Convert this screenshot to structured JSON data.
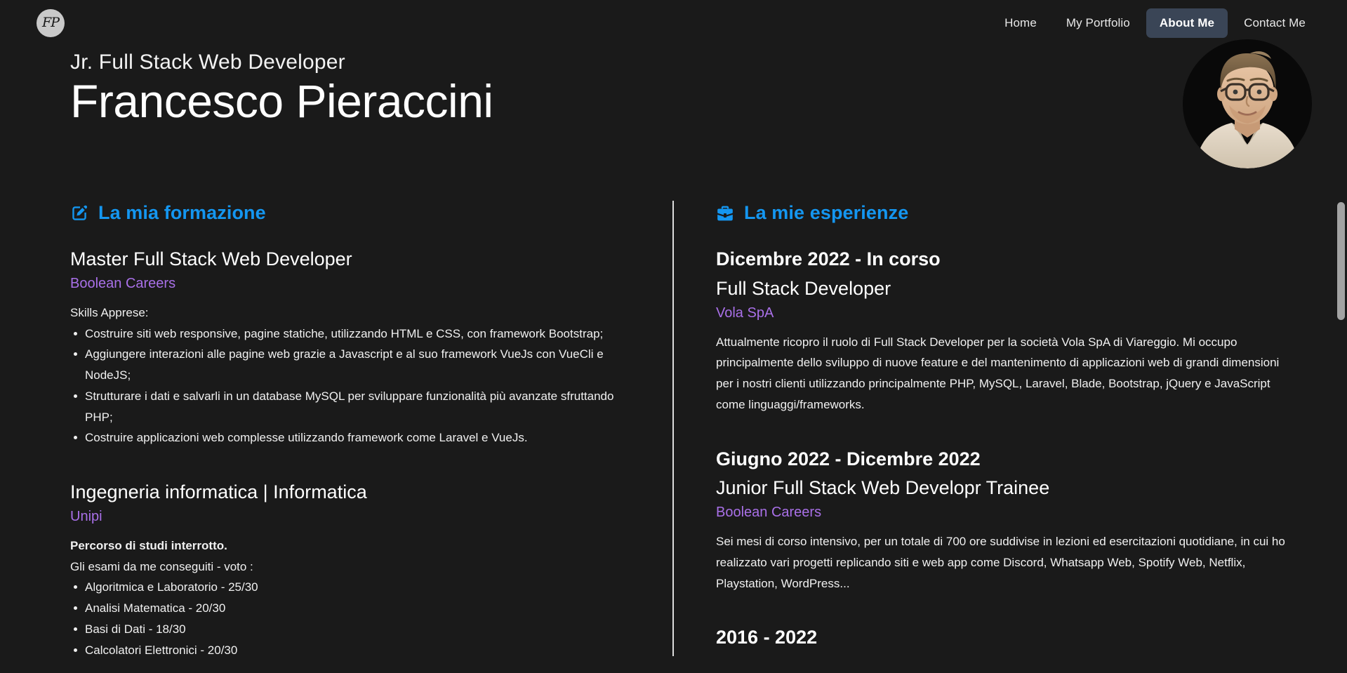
{
  "navbar": {
    "logo_text": "FP",
    "logo_icon": "fp-monogram-icon",
    "links": [
      {
        "label": "Home",
        "active": false
      },
      {
        "label": "My Portfolio",
        "active": false
      },
      {
        "label": "About Me",
        "active": true
      },
      {
        "label": "Contact Me",
        "active": false
      }
    ]
  },
  "hero": {
    "role": "Jr. Full Stack Web Developer",
    "name": "Francesco Pieraccini",
    "avatar_alt": "profile-photo"
  },
  "education": {
    "icon": "pencil-square-icon",
    "title": "La mia formazione",
    "entries": [
      {
        "title": "Master Full Stack Web Developer",
        "org": "Boolean Careers",
        "intro": "Skills Apprese:",
        "bullets": [
          "Costruire siti web responsive, pagine statiche, utilizzando HTML e CSS, con framework Bootstrap;",
          "Aggiungere interazioni alle pagine web grazie a Javascript e al suo framework VueJs con VueCli e NodeJS;",
          "Strutturare i dati e salvarli in un database MySQL per sviluppare funzionalità più avanzate sfruttando PHP;",
          "Costruire applicazioni web complesse utilizzando framework come Laravel e VueJs."
        ]
      },
      {
        "title": "Ingegneria informatica | Informatica",
        "org": "Unipi",
        "note": "Percorso di studi interrotto.",
        "intro": "Gli esami da me conseguiti - voto :",
        "bullets": [
          "Algoritmica e Laboratorio - 25/30",
          "Analisi Matematica - 20/30",
          "Basi di Dati - 18/30",
          "Calcolatori Elettronici - 20/30"
        ]
      }
    ]
  },
  "experience": {
    "icon": "briefcase-icon",
    "title": "La mie esperienze",
    "entries": [
      {
        "date": "Dicembre 2022 - In corso",
        "title": "Full Stack Developer",
        "org": "Vola SpA",
        "description": "Attualmente ricopro il ruolo di Full Stack Developer per la società Vola SpA di Viareggio. Mi occupo principalmente dello sviluppo di nuove feature e del mantenimento di applicazioni web di grandi dimensioni per i nostri clienti utilizzando principalmente PHP, MySQL, Laravel, Blade, Bootstrap, jQuery e JavaScript come linguaggi/frameworks."
      },
      {
        "date": "Giugno 2022 - Dicembre 2022",
        "title": "Junior Full Stack Web Developr Trainee",
        "org": "Boolean Careers",
        "description": "Sei mesi di corso intensivo, per un totale di 700 ore suddivise in lezioni ed esercitazioni quotidiane, in cui ho realizzato vari progetti replicando siti e web app come Discord, Whatsapp Web, Spotify Web, Netflix, Playstation, WordPress..."
      },
      {
        "date": "2016 - 2022",
        "title": "",
        "org": "",
        "description": ""
      }
    ]
  },
  "colors": {
    "background": "#1a1a1a",
    "accent_blue": "#1496f0",
    "accent_purple": "#a970e8",
    "nav_active_bg": "#3a4556",
    "text": "#f2f2f2",
    "divider": "#dcdcdc",
    "scrollbar": "#a3a3a3"
  }
}
